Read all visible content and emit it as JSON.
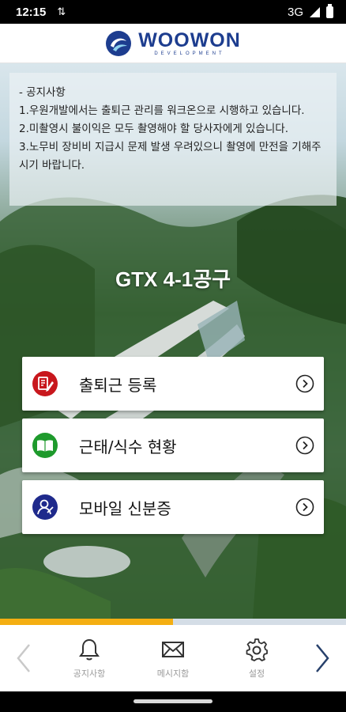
{
  "status_bar": {
    "time": "12:15",
    "network": "3G",
    "icons": [
      "sync-icon",
      "signal-icon",
      "battery-icon"
    ]
  },
  "header": {
    "logo_name": "WOOWON",
    "logo_sub": "DEVELOPMENT",
    "brand_color": "#1d3d8f"
  },
  "notice": {
    "title": "- 공지사항",
    "lines": [
      "1.우원개발에서는 출퇴근 관리를 워크온으로 시행하고 있습니다.",
      "2.미촬영시 불이익은 모두 촬영해야 할 당사자에게 있습니다.",
      "3.노무비 장비비 지급시 문제 발생 우려있으니 촬영에 만전을 기해주시기 바랍니다."
    ]
  },
  "site_title": "GTX 4-1공구",
  "menu": [
    {
      "label": "출퇴근 등록",
      "icon": "attendance-register-icon",
      "icon_color": "#c8171d"
    },
    {
      "label": "근태/식수 현황",
      "icon": "book-icon",
      "icon_color": "#1e9a2c"
    },
    {
      "label": "모바일 신분증",
      "icon": "id-user-icon",
      "icon_color": "#1f2a8c"
    }
  ],
  "progress": {
    "value": 0.5,
    "fill_color": "#f4ae12"
  },
  "bottom_nav": {
    "items": [
      {
        "label": "공지사항",
        "icon": "bell-icon"
      },
      {
        "label": "메시지함",
        "icon": "envelope-icon"
      },
      {
        "label": "설정",
        "icon": "gear-icon"
      }
    ],
    "prev_icon": "chevron-left-icon",
    "next_icon": "chevron-right-icon"
  }
}
